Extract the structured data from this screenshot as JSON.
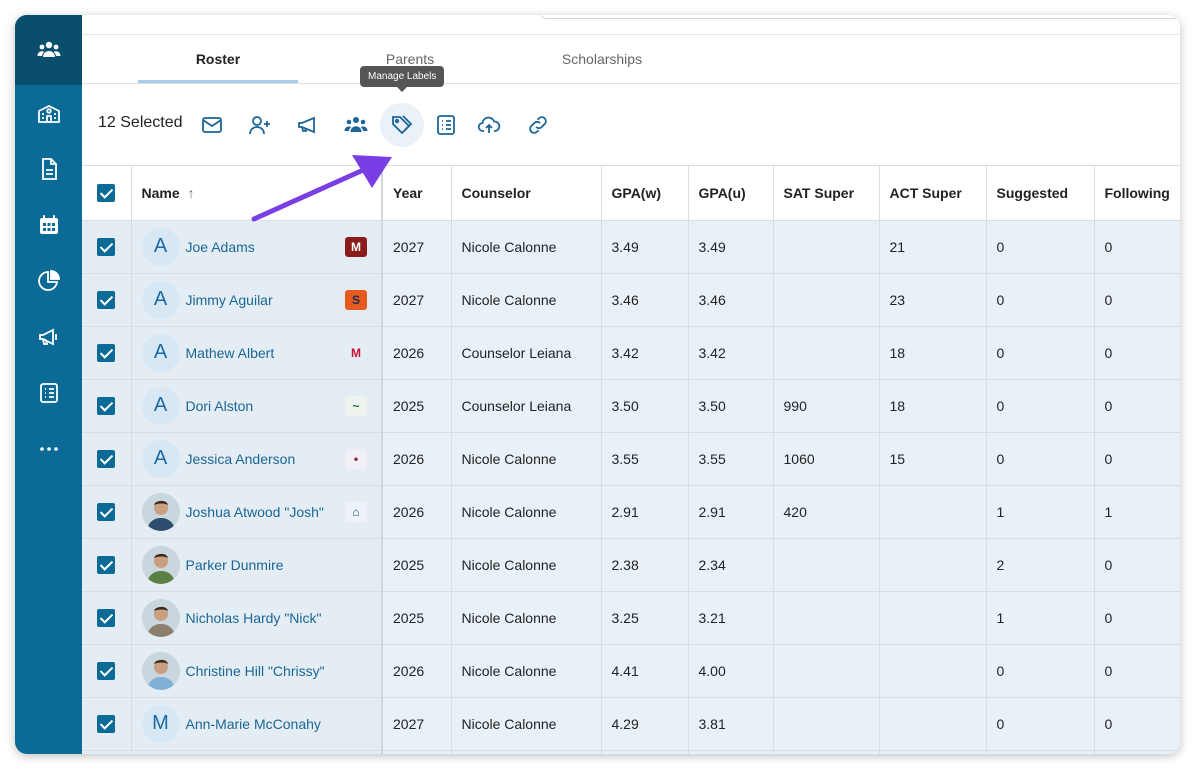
{
  "tabs": [
    {
      "label": "Roster",
      "active": true
    },
    {
      "label": "Parents",
      "active": false
    },
    {
      "label": "Scholarships",
      "active": false
    }
  ],
  "tooltip": "Manage Labels",
  "toolbar": {
    "selected_count": "12 Selected",
    "actions": [
      "envelope-icon",
      "add-user-icon",
      "megaphone-icon",
      "group-icon",
      "tags-icon",
      "checklist-icon",
      "cloud-upload-icon",
      "link-icon"
    ]
  },
  "sidebar": {
    "items": [
      "students-icon",
      "school-icon",
      "document-icon",
      "calendar-icon",
      "pie-chart-icon",
      "megaphone-icon",
      "checklist-icon",
      "more-icon"
    ]
  },
  "table": {
    "headers": {
      "name": "Name",
      "sort": "↑",
      "year": "Year",
      "counselor": "Counselor",
      "gpa_w": "GPA(w)",
      "gpa_u": "GPA(u)",
      "sat": "SAT Super",
      "act": "ACT Super",
      "suggested": "Suggested",
      "following": "Following"
    },
    "rows": [
      {
        "initial": "A",
        "name": "Joe Adams",
        "year": "2027",
        "counselor": "Nicole Calonne",
        "gpa_w": "3.49",
        "gpa_u": "3.49",
        "sat": "",
        "act": "21",
        "suggested": "0",
        "following": "0"
      },
      {
        "initial": "A",
        "name": "Jimmy Aguilar",
        "year": "2027",
        "counselor": "Nicole Calonne",
        "gpa_w": "3.46",
        "gpa_u": "3.46",
        "sat": "",
        "act": "23",
        "suggested": "0",
        "following": "0"
      },
      {
        "initial": "A",
        "name": "Mathew Albert",
        "year": "2026",
        "counselor": "Counselor Leiana",
        "gpa_w": "3.42",
        "gpa_u": "3.42",
        "sat": "",
        "act": "18",
        "suggested": "0",
        "following": "0"
      },
      {
        "initial": "A",
        "name": "Dori Alston",
        "year": "2025",
        "counselor": "Counselor Leiana",
        "gpa_w": "3.50",
        "gpa_u": "3.50",
        "sat": "990",
        "act": "18",
        "suggested": "0",
        "following": "0"
      },
      {
        "initial": "A",
        "name": "Jessica Anderson",
        "year": "2026",
        "counselor": "Nicole Calonne",
        "gpa_w": "3.55",
        "gpa_u": "3.55",
        "sat": "1060",
        "act": "15",
        "suggested": "0",
        "following": "0"
      },
      {
        "initial": "",
        "name": "Joshua Atwood \"Josh\"",
        "year": "2026",
        "counselor": "Nicole Calonne",
        "gpa_w": "2.91",
        "gpa_u": "2.91",
        "sat": "420",
        "act": "",
        "suggested": "1",
        "following": "1"
      },
      {
        "initial": "",
        "name": "Parker Dunmire",
        "year": "2025",
        "counselor": "Nicole Calonne",
        "gpa_w": "2.38",
        "gpa_u": "2.34",
        "sat": "",
        "act": "",
        "suggested": "2",
        "following": "0"
      },
      {
        "initial": "",
        "name": "Nicholas Hardy \"Nick\"",
        "year": "2025",
        "counselor": "Nicole Calonne",
        "gpa_w": "3.25",
        "gpa_u": "3.21",
        "sat": "",
        "act": "",
        "suggested": "1",
        "following": "0"
      },
      {
        "initial": "",
        "name": "Christine Hill \"Chrissy\"",
        "year": "2026",
        "counselor": "Nicole Calonne",
        "gpa_w": "4.41",
        "gpa_u": "4.00",
        "sat": "",
        "act": "",
        "suggested": "0",
        "following": "0"
      },
      {
        "initial": "M",
        "name": "Ann-Marie McConahy",
        "year": "2027",
        "counselor": "Nicole Calonne",
        "gpa_w": "4.29",
        "gpa_u": "3.81",
        "sat": "",
        "act": "",
        "suggested": "0",
        "following": "0"
      }
    ]
  },
  "colors": {
    "sidebar": "#0b6a96",
    "accent": "#0b6a96",
    "row_bg": "#e8f1f8",
    "arrow": "#7a3fe4"
  }
}
